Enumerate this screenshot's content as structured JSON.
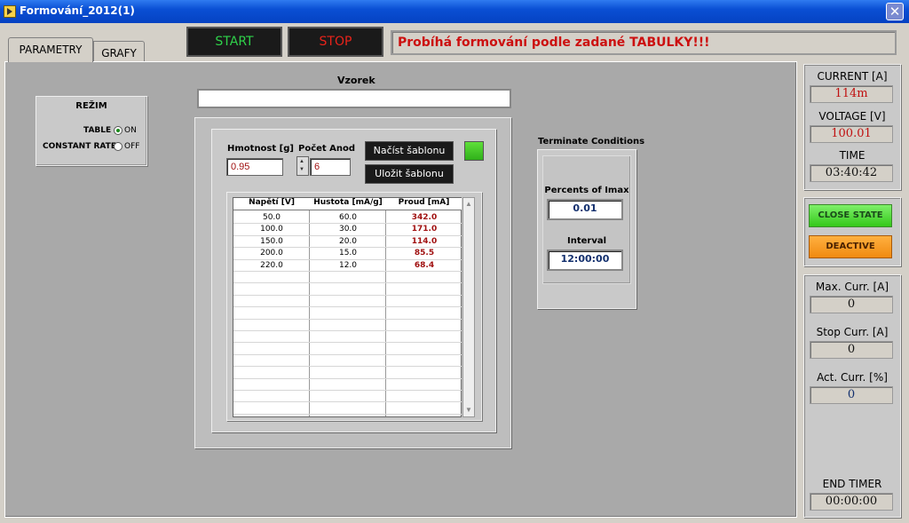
{
  "window": {
    "title": "Formování_2012(1)"
  },
  "tabs": [
    {
      "label": "PARAMETRY"
    },
    {
      "label": "GRAFY"
    }
  ],
  "toolbar": {
    "start_label": "START",
    "stop_label": "STOP",
    "status_message": "Probíhá formování podle zadané TABULKY!!!"
  },
  "rezim": {
    "title": "REŽIM",
    "table_label": "TABLE",
    "table_state": "ON",
    "constant_rate_label": "CONSTANT RATE",
    "constant_rate_state": "OFF",
    "selected": "TABLE"
  },
  "vzorek": {
    "label": "Vzorek",
    "value": ""
  },
  "sample": {
    "hmotnost_label": "Hmotnost [g]",
    "hmotnost_value": "0.95",
    "pocet_anod_label": "Počet Anod",
    "pocet_anod_value": "6",
    "load_template_label": "Načíst šablonu",
    "save_template_label": "Uložit šablonu",
    "led_color": "#3fd22a"
  },
  "table": {
    "headers": [
      "Napětí [V]",
      "Hustota [mA/g]",
      "Proud [mA]"
    ],
    "rows": [
      [
        "50.0",
        "60.0",
        "342.0"
      ],
      [
        "100.0",
        "30.0",
        "171.0"
      ],
      [
        "150.0",
        "20.0",
        "114.0"
      ],
      [
        "200.0",
        "15.0",
        "85.5"
      ],
      [
        "220.0",
        "12.0",
        "68.4"
      ]
    ]
  },
  "terminate": {
    "title": "Terminate Conditions",
    "percents_label": "Percents of Imax",
    "percents_value": "0.01",
    "interval_label": "Interval",
    "interval_value": "12:00:00"
  },
  "monitor": {
    "current_label": "CURRENT [A]",
    "current_value": "114m",
    "voltage_label": "VOLTAGE [V]",
    "voltage_value": "100.01",
    "time_label": "TIME",
    "time_value": "03:40:42"
  },
  "state_buttons": {
    "close_state_label": "CLOSE STATE",
    "deactive_label": "DEACTIVE"
  },
  "currents": {
    "max_label": "Max. Curr. [A]",
    "max_value": "0",
    "stop_label": "Stop Curr. [A]",
    "stop_value": "0",
    "act_label": "Act. Curr. [%]",
    "act_value": "0",
    "end_timer_label": "END TIMER",
    "end_timer_value": "00:00:00"
  },
  "colors": {
    "value_red": "#c01010",
    "value_blue": "#13306e",
    "start_green": "#2fd24a",
    "stop_red": "#e8231a"
  }
}
